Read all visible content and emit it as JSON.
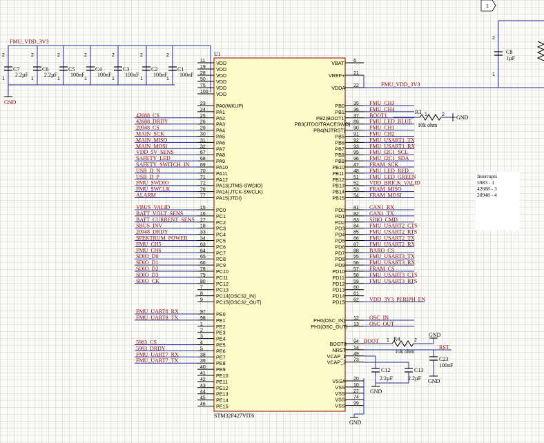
{
  "header": {
    "top_right_tag": "1"
  },
  "power_net_left": "FMU_VDD_3V3",
  "power_net_right": "FMU_VDD_3V3",
  "gnd_label": "GND",
  "decoupling_caps": [
    {
      "ref": "C7",
      "value": "2.2µF"
    },
    {
      "ref": "C6",
      "value": "2.2µF"
    },
    {
      "ref": "C5",
      "value": "100nF"
    },
    {
      "ref": "C4",
      "value": "100nF"
    },
    {
      "ref": "C3",
      "value": "100nF"
    },
    {
      "ref": "C2",
      "value": "100nF"
    },
    {
      "ref": "C1",
      "value": "100nF"
    }
  ],
  "right_cap": {
    "ref": "C8",
    "value": "1µF"
  },
  "chip": {
    "ref": "U1",
    "part": "STM32F427VIT6"
  },
  "vdd_pins": [
    {
      "num": "11",
      "name": "VDD"
    },
    {
      "num": "19",
      "name": "VDD"
    },
    {
      "num": "28",
      "name": "VDD"
    },
    {
      "num": "50",
      "name": "VDD"
    },
    {
      "num": "75",
      "name": "VDD"
    },
    {
      "num": "100",
      "name": "VDD"
    }
  ],
  "right_power_pins": [
    {
      "num": "6",
      "name": "VBAT"
    },
    {
      "num": "21",
      "name": "VREF+"
    },
    {
      "num": "22",
      "name": "VDDA"
    }
  ],
  "left_pins": [
    {
      "num": "23",
      "name": "PA0(WKUP)",
      "net": ""
    },
    {
      "num": "24",
      "name": "PA1",
      "net": ""
    },
    {
      "num": "25",
      "name": "PA2",
      "net": "42688_CS"
    },
    {
      "num": "26",
      "name": "PA3",
      "net": "42688_DRDY"
    },
    {
      "num": "29",
      "name": "PA4",
      "net": "20948_CS"
    },
    {
      "num": "30",
      "name": "PA5",
      "net": "MAIN_SCK"
    },
    {
      "num": "31",
      "name": "PA6",
      "net": "MAIN_MISO"
    },
    {
      "num": "32",
      "name": "PA7",
      "net": "MAIN_MOSI"
    },
    {
      "num": "67",
      "name": "PA8",
      "net": "VDD_5V_SENS"
    },
    {
      "num": "68",
      "name": "PA9",
      "net": "SAFETY_LED"
    },
    {
      "num": "69",
      "name": "PA10",
      "net": "SAFETY_SWITCH_IN"
    },
    {
      "num": "70",
      "name": "PA11",
      "net": "USB_D_N"
    },
    {
      "num": "71",
      "name": "PA12",
      "net": "USB_D_P"
    },
    {
      "num": "72",
      "name": "PA13(JTMS-SWDIO)",
      "net": "FMU_SWDIO"
    },
    {
      "num": "76",
      "name": "PA14(JTCK-SWCLK)",
      "net": "FMU_SWCLK"
    },
    {
      "num": "77",
      "name": "PA15(JTDI)",
      "net": "ALARM"
    },
    {
      "num": "15",
      "name": "PC0",
      "net": "VBUS_VALID"
    },
    {
      "num": "16",
      "name": "PC1",
      "net": "BATT_VOLT_SENS"
    },
    {
      "num": "17",
      "name": "PC2",
      "net": "BATT_CURRENT_SENS"
    },
    {
      "num": "18",
      "name": "PC3",
      "net": "SBUS_INV"
    },
    {
      "num": "33",
      "name": "PC4",
      "net": "20948_DRDY"
    },
    {
      "num": "34",
      "name": "PC5",
      "net": "SPEKTRUM_POWER"
    },
    {
      "num": "63",
      "name": "PC6",
      "net": "FMU_CH5"
    },
    {
      "num": "64",
      "name": "PC7",
      "net": "FMU_CH6"
    },
    {
      "num": "65",
      "name": "PC8",
      "net": "SDIO_D0"
    },
    {
      "num": "66",
      "name": "PC9",
      "net": "SDIO_D1"
    },
    {
      "num": "78",
      "name": "PC10",
      "net": "SDIO_D2"
    },
    {
      "num": "79",
      "name": "PC11",
      "net": "SDIO_D3"
    },
    {
      "num": "80",
      "name": "PC12",
      "net": "SDIO_CK"
    },
    {
      "num": "7",
      "name": "PC13",
      "net": ""
    },
    {
      "num": "8",
      "name": "PC14(OSC32_IN)",
      "net": ""
    },
    {
      "num": "9",
      "name": "PC15(OSC32_OUT)",
      "net": ""
    },
    {
      "num": "97",
      "name": "PE0",
      "net": "FMU_UART8_RX"
    },
    {
      "num": "98",
      "name": "PE1",
      "net": "FMU_UART8_TX"
    },
    {
      "num": "1",
      "name": "PE2",
      "net": ""
    },
    {
      "num": "2",
      "name": "PE3",
      "net": ""
    },
    {
      "num": "3",
      "name": "PE4",
      "net": ""
    },
    {
      "num": "4",
      "name": "PE5",
      "net": "5983_CS"
    },
    {
      "num": "5",
      "name": "PE6",
      "net": "5983_DRDY"
    },
    {
      "num": "38",
      "name": "PE7",
      "net": "FMU_UART7_RX"
    },
    {
      "num": "39",
      "name": "PE8",
      "net": "FMU_UART7_TX"
    },
    {
      "num": "40",
      "name": "PE9",
      "net": ""
    },
    {
      "num": "41",
      "name": "PE10",
      "net": ""
    },
    {
      "num": "42",
      "name": "PE11",
      "net": ""
    },
    {
      "num": "43",
      "name": "PE12",
      "net": ""
    },
    {
      "num": "44",
      "name": "PE13",
      "net": ""
    },
    {
      "num": "45",
      "name": "PE14",
      "net": ""
    },
    {
      "num": "46",
      "name": "PE15",
      "net": ""
    }
  ],
  "right_pins": [
    {
      "num": "35",
      "name": "PB0",
      "net": "FMU_CH3"
    },
    {
      "num": "36",
      "name": "PB1",
      "net": "FMU_CH4"
    },
    {
      "num": "37",
      "name": "PB2(BOOT1)",
      "net": "BOOT1"
    },
    {
      "num": "89",
      "name": "PB3(JTDO/TRACESWO)",
      "net": "FMU_LED_BLUE"
    },
    {
      "num": "90",
      "name": "PB4(NJTRST)",
      "net": "FMU_CH1"
    },
    {
      "num": "91",
      "name": "PB5",
      "net": "FMU_CH2"
    },
    {
      "num": "92",
      "name": "PB6",
      "net": "FMU_USART1_TX"
    },
    {
      "num": "93",
      "name": "PB7",
      "net": "FMU_USART1_RX"
    },
    {
      "num": "95",
      "name": "PB8",
      "net": "FMU_I2C1_SCL"
    },
    {
      "num": "96",
      "name": "PB9",
      "net": "FMU_I2C1_SDA"
    },
    {
      "num": "47",
      "name": "PB10",
      "net": "FRAM_SCK"
    },
    {
      "num": "48",
      "name": "PB11",
      "net": "FMU_LED_RED"
    },
    {
      "num": "51",
      "name": "PB12",
      "net": "FMU_LED_GREEN"
    },
    {
      "num": "52",
      "name": "PB13",
      "net": "VDD_BRICK_VALID"
    },
    {
      "num": "53",
      "name": "PB14",
      "net": "FRAM_MISO"
    },
    {
      "num": "54",
      "name": "PB15",
      "net": "FRAM_MOSI"
    },
    {
      "num": "81",
      "name": "PD0",
      "net": "CAN1_RX"
    },
    {
      "num": "82",
      "name": "PD1",
      "net": "CAN1_TX"
    },
    {
      "num": "83",
      "name": "PD2",
      "net": "SDIO_CMD"
    },
    {
      "num": "84",
      "name": "PD3",
      "net": "FMU_USART2_CTS"
    },
    {
      "num": "85",
      "name": "PD4",
      "net": "FMU_USART2_RTS"
    },
    {
      "num": "86",
      "name": "PD5",
      "net": "FMU_USART2_TX"
    },
    {
      "num": "87",
      "name": "PD6",
      "net": "FMU_USART2_RX"
    },
    {
      "num": "88",
      "name": "PD7",
      "net": "BARO_CS"
    },
    {
      "num": "55",
      "name": "PD8",
      "net": "FMU_USART3_TX"
    },
    {
      "num": "56",
      "name": "PD9",
      "net": "FMU_USART3_RX"
    },
    {
      "num": "57",
      "name": "PD10",
      "net": "FRAM_CS"
    },
    {
      "num": "58",
      "name": "PD11",
      "net": "FMU_USART3_CTS"
    },
    {
      "num": "59",
      "name": "PD12",
      "net": "FMU_USART3_RTS"
    },
    {
      "num": "60",
      "name": "PD13",
      "net": ""
    },
    {
      "num": "61",
      "name": "PD14",
      "net": ""
    },
    {
      "num": "62",
      "name": "PD15",
      "net": "VDD_3V3_PERIPH_EN"
    },
    {
      "num": "12",
      "name": "PH0(OSC_IN)",
      "net": "OSC_IN"
    },
    {
      "num": "13",
      "name": "PH1(OSC_OUT)",
      "net": "OSC_OUT"
    },
    {
      "num": "94",
      "name": "BOOT0",
      "net": "BOOT"
    },
    {
      "num": "14",
      "name": "NRST",
      "net": "RST"
    },
    {
      "num": "49",
      "name": "VCAP_1",
      "net": ""
    },
    {
      "num": "73",
      "name": "VCAP_2",
      "net": ""
    },
    {
      "num": "20",
      "name": "VSSA",
      "net": ""
    },
    {
      "num": "10",
      "name": "VSS",
      "net": ""
    },
    {
      "num": "27",
      "name": "VSS",
      "net": ""
    },
    {
      "num": "74",
      "name": "VSS",
      "net": ""
    },
    {
      "num": "99",
      "name": "VSS",
      "net": ""
    }
  ],
  "resistors": [
    {
      "ref": "R3",
      "value": "10k ohm"
    },
    {
      "ref": "R4",
      "value": "10k ohm"
    }
  ],
  "pin_numbers_small": {
    "r3_pin1": "1",
    "r3_pin2": "2",
    "r4_pin1": "1",
    "r4_pin2": "2",
    "c_pin1": "1",
    "c_pin2": "2"
  },
  "bottom_caps": [
    {
      "ref": "C12",
      "value": "2.2µF"
    },
    {
      "ref": "C13",
      "value": "2.2µF"
    },
    {
      "ref": "C23",
      "value": "100nF"
    }
  ],
  "interrupts_note": {
    "title": "Interrupts",
    "lines": [
      "5983 - 1",
      "42688 - 3",
      "20948 - 4"
    ]
  },
  "colors": {
    "wire": "#1f2a9c",
    "chip_fill": "#fdfcc8",
    "chip_border": "#8b0000",
    "net_label": "#8b0000"
  }
}
